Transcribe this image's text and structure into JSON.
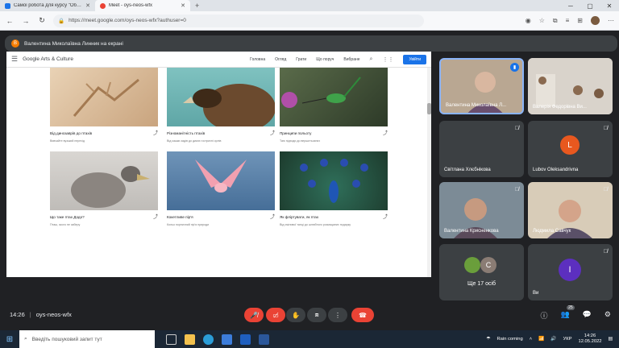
{
  "browser": {
    "tabs": [
      {
        "title": "Самоі робота для курсу \"Об…",
        "active": false,
        "icon": "docs-icon",
        "color": "#1a73e8"
      },
      {
        "title": "Meet - oys-neos-wfx",
        "active": true,
        "icon": "meet-icon",
        "color": "#ea4335"
      }
    ],
    "new_tab": "+",
    "url": "https://meet.google.com/oys-neos-wfx?authuser=0"
  },
  "presenter_bar": {
    "initial": "В",
    "text": "Валентина Миколаївна Линник на екрані"
  },
  "arts_culture": {
    "brand": "Google Arts & Culture",
    "nav": [
      "Головна",
      "Огляд",
      "Грати",
      "Що поруч",
      "Вибране"
    ],
    "login": "Увійти",
    "cards": [
      {
        "title": "Від динозаврів до птахів",
        "subtitle": "Вивчайте вузький перехід"
      },
      {
        "title": "Різноманітність птахів",
        "subtitle": "Від кашки задів до диких гострихні орлів"
      },
      {
        "title": "Принципи польоту",
        "subtitle": "Таю підходи до вершитьозних"
      },
      {
        "title": "Що таке птах Додо?",
        "subtitle": "Пташ, якого не заберу"
      },
      {
        "title": "Кокетливе пір'я",
        "subtitle": "Кольо порничний пір'я природи"
      },
      {
        "title": "Як фліртувати, як птах",
        "subtitle": "Від сміливої танці до шлюбного розмацаних подарку"
      }
    ]
  },
  "participants": [
    {
      "name": "Валентина Миколаївна Л...",
      "speaking": true
    },
    {
      "name": "Валерія Федорівна Ви..."
    },
    {
      "name": "Світлана Хлєбнікова"
    },
    {
      "name": "Lubov Oleksandrivna",
      "initial": "L",
      "color": "#e8581f"
    },
    {
      "name": "Валентина Крисненкова"
    },
    {
      "name": "Людмила Савчук"
    },
    {
      "name": "Ще 17 осіб",
      "initial": "C"
    },
    {
      "name": "Ви",
      "initial": "I",
      "color": "#5c2fbf"
    }
  ],
  "meeting": {
    "time": "14:26",
    "separator": "|",
    "code": "oys-neos-wfx",
    "participants_count": "25"
  },
  "taskbar": {
    "search_placeholder": "Введіть пошуковий запит тут",
    "weather": "Rain coming",
    "lang": "УКР",
    "time": "14:26",
    "date": "12.05.2022"
  }
}
